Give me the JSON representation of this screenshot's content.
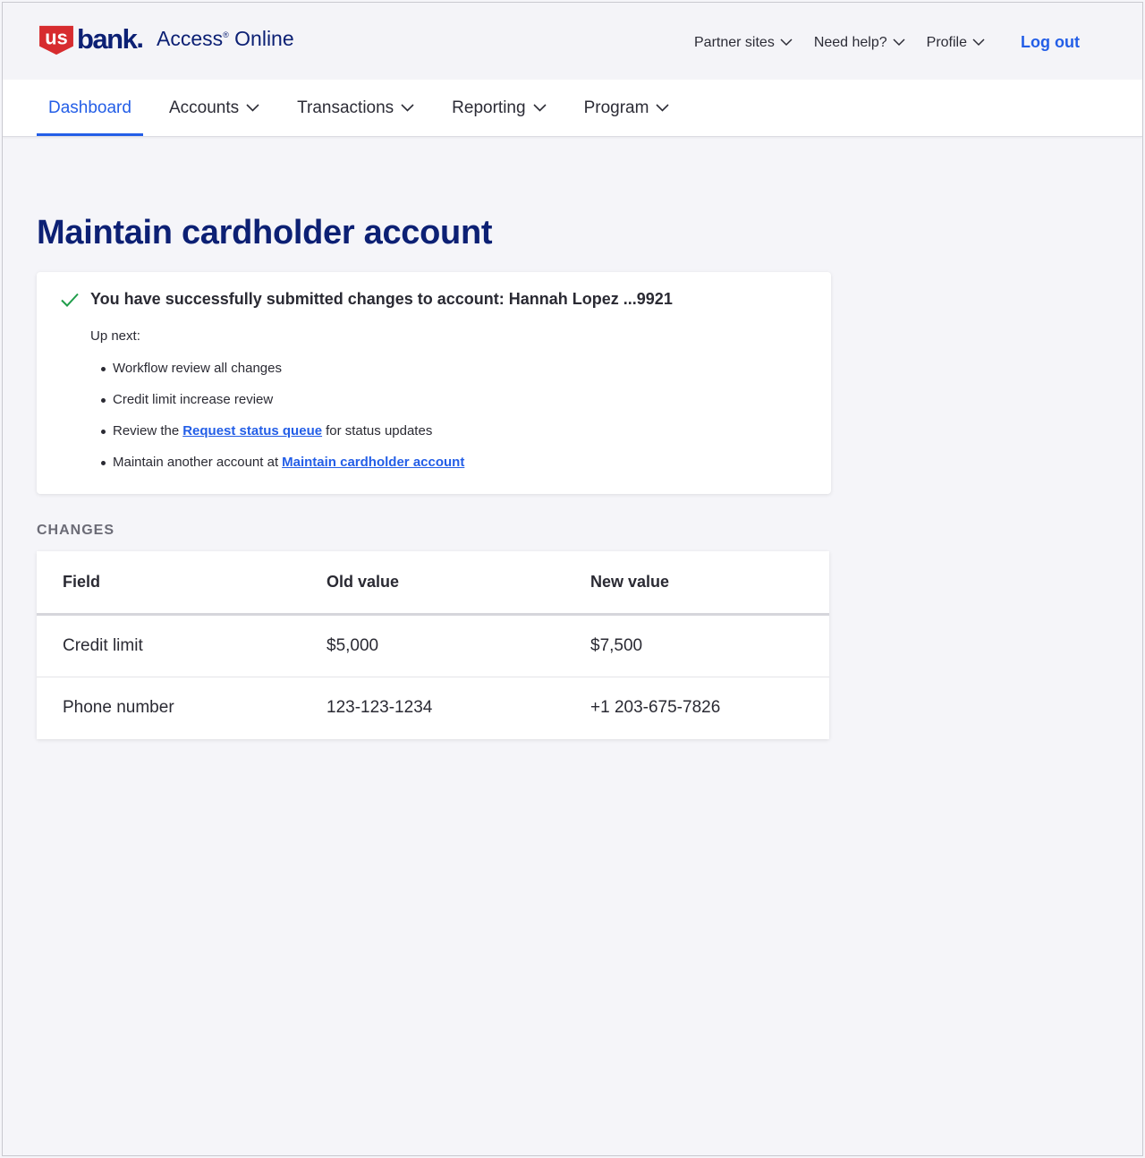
{
  "brand": {
    "logo_us": "us",
    "logo_bank": "bank",
    "logo_dot": ".",
    "product": "Access",
    "product_mark": "®",
    "product_suffix": "Online",
    "colors": {
      "navy": "#0c2074",
      "red": "#d72c2f",
      "link": "#235ee7"
    }
  },
  "utility_nav": {
    "partner_sites": "Partner sites",
    "need_help": "Need help?",
    "profile": "Profile",
    "logout": "Log out"
  },
  "main_nav": {
    "items": [
      {
        "label": "Dashboard",
        "active": true
      },
      {
        "label": "Accounts"
      },
      {
        "label": "Transactions"
      },
      {
        "label": "Reporting"
      },
      {
        "label": "Program"
      }
    ]
  },
  "page": {
    "title": "Maintain cardholder account"
  },
  "confirmation": {
    "icon": "check-icon",
    "message": "You have successfully submitted changes to account: Hannah Lopez ...9921",
    "up_next_label": "Up next:",
    "items": [
      {
        "text": "Workflow review all changes"
      },
      {
        "text": "Credit limit increase review"
      },
      {
        "prefix": "Review the",
        "link": "Request status queue",
        "suffix": "for status updates"
      },
      {
        "prefix": "Maintain another account at",
        "link": "Maintain cardholder account"
      }
    ]
  },
  "changes": {
    "section_label": "CHANGES",
    "headers": [
      "Field",
      "Old value",
      "New value"
    ],
    "rows": [
      [
        "Credit limit",
        "$5,000",
        "$7,500"
      ],
      [
        "Phone number",
        "123-123-1234",
        "+1 203-675-7826"
      ]
    ]
  }
}
